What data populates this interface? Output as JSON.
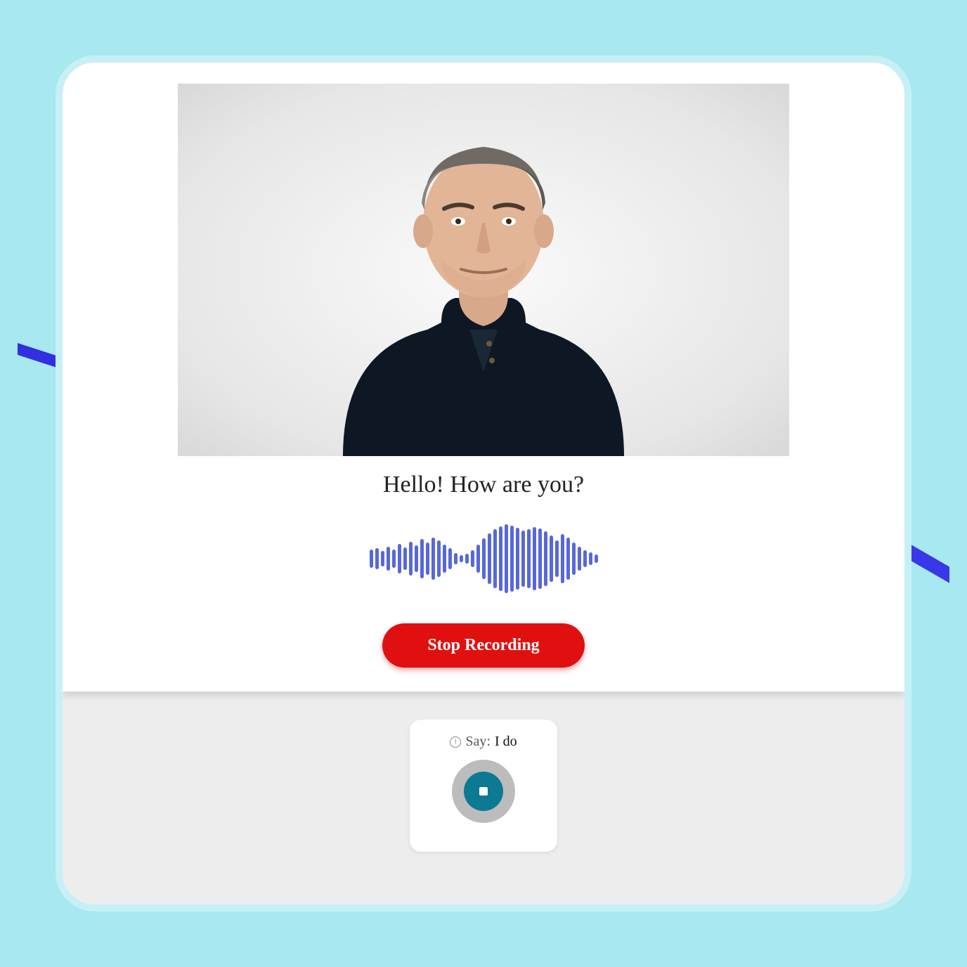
{
  "prompt_text": "Hello! How are you?",
  "stop_button_label": "Stop Recording",
  "say_card": {
    "prefix": "Say:",
    "phrase": "I do"
  },
  "colors": {
    "accent_red": "#e01010",
    "wave_blue": "#5868d8",
    "record_teal": "#0b7a92",
    "bg_cyan": "#a8e8f0"
  },
  "waveform_heights": [
    26,
    30,
    22,
    34,
    26,
    42,
    32,
    48,
    38,
    56,
    46,
    60,
    52,
    40,
    30,
    16,
    10,
    14,
    24,
    40,
    58,
    72,
    84,
    92,
    98,
    94,
    88,
    80,
    84,
    90,
    86,
    78,
    66,
    52,
    70,
    60,
    46,
    34,
    24,
    18,
    12
  ]
}
